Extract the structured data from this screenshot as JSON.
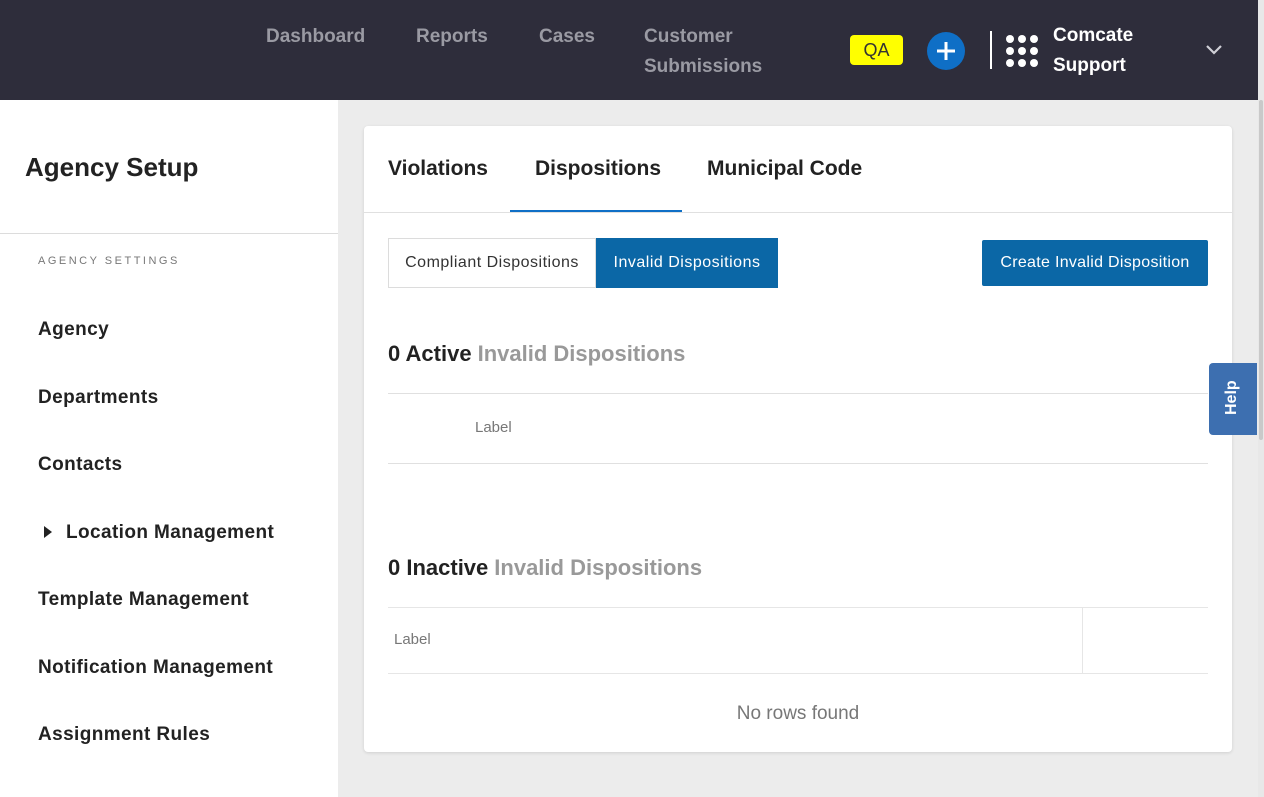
{
  "nav": {
    "items": [
      "Dashboard",
      "Reports",
      "Cases",
      "Customer Submissions"
    ],
    "env_badge": "QA",
    "org_name": "Comcate Support",
    "add_icon": "plus-icon",
    "apps_icon": "grid-icon",
    "menu_icon": "chevron-down-icon",
    "colors": {
      "bar": "#2e2d3b",
      "badge": "#ffff00",
      "accent": "#0f6fc6"
    }
  },
  "sidebar": {
    "title": "Agency Setup",
    "section": "AGENCY SETTINGS",
    "items": [
      {
        "label": "Agency"
      },
      {
        "label": "Departments"
      },
      {
        "label": "Contacts"
      },
      {
        "label": "Location Management",
        "expandable": true
      },
      {
        "label": "Template Management"
      },
      {
        "label": "Notification Management"
      },
      {
        "label": "Assignment Rules"
      }
    ]
  },
  "main": {
    "tabs": [
      {
        "label": "Violations"
      },
      {
        "label": "Dispositions",
        "active": true
      },
      {
        "label": "Municipal Code"
      }
    ],
    "segments": [
      {
        "label": "Compliant Dispositions",
        "active": false
      },
      {
        "label": "Invalid Dispositions",
        "active": true
      }
    ],
    "create_button": "Create Invalid Disposition",
    "active_section": {
      "count": "0 Active",
      "label": "Invalid Dispositions",
      "column": "Label"
    },
    "inactive_section": {
      "count": "0 Inactive",
      "label": "Invalid Dispositions",
      "column": "Label",
      "empty_text": "No rows found"
    }
  },
  "help": {
    "label": "Help"
  }
}
